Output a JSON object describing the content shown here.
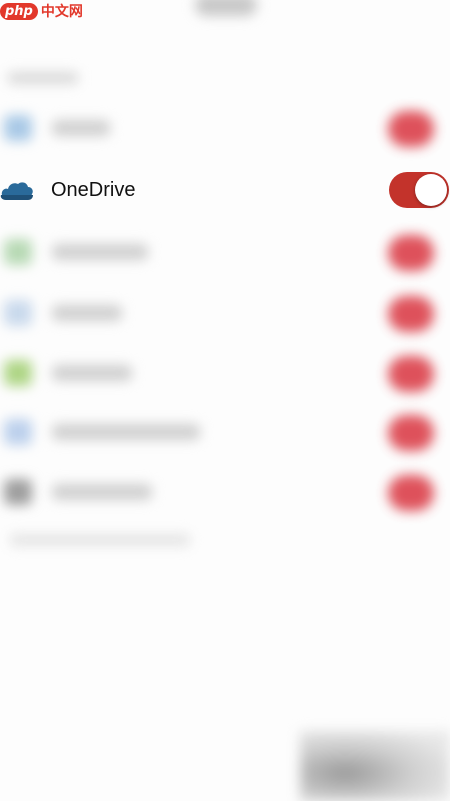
{
  "watermark": {
    "logo": "php",
    "text": "中文网"
  },
  "accounts": {
    "onedrive": {
      "label": "OneDrive",
      "icon": "onedrive-cloud-icon",
      "enabled": true
    }
  },
  "colors": {
    "toggle_on": "#c3332b",
    "onedrive_icon": "#2a6a9a",
    "watermark": "#e2382b"
  }
}
